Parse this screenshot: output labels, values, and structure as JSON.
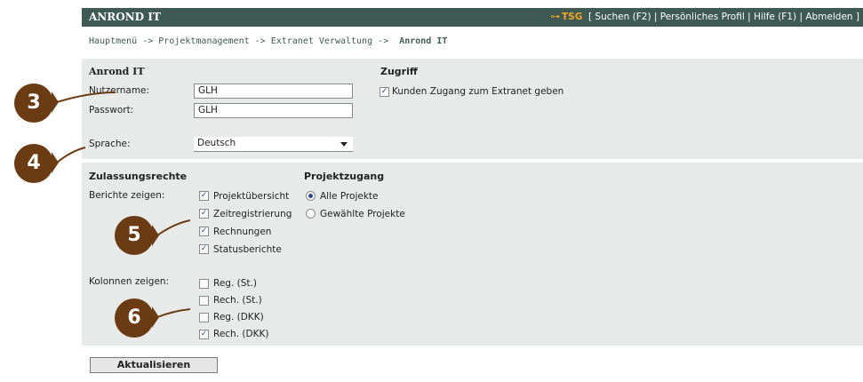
{
  "topbar": {
    "title": "ANROND IT",
    "user": "TSG",
    "links": "[ Suchen (F2) | Persönliches Profil | Hilfe (F1) | Abmelden ]"
  },
  "breadcrumb": {
    "path": "Hauptmenü -> Projektmanagement -> Extranet Verwaltung ->",
    "current": "Anrond IT"
  },
  "account": {
    "heading": "Anrond IT",
    "username_label": "Nutzername:",
    "username_value": "GLH",
    "password_label": "Passwort:",
    "password_value": "GLH",
    "language_label": "Sprache:",
    "language_value": "Deutsch"
  },
  "access": {
    "heading": "Zugriff",
    "extranet_label": "Kunden Zugang zum Extranet geben",
    "extranet_checked": true
  },
  "permissions": {
    "heading": "Zulassungsrechte",
    "reports_label": "Berichte zeigen:",
    "reports": [
      {
        "label": "Projektübersicht",
        "checked": true
      },
      {
        "label": "Zeitregistrierung",
        "checked": true
      },
      {
        "label": "Rechnungen",
        "checked": true
      },
      {
        "label": "Statusberichte",
        "checked": true
      }
    ],
    "columns_label": "Kolonnen zeigen:",
    "columns": [
      {
        "label": "Reg. (St.)",
        "checked": false
      },
      {
        "label": "Rech. (St.)",
        "checked": false
      },
      {
        "label": "Reg. (DKK)",
        "checked": false
      },
      {
        "label": "Rech. (DKK)",
        "checked": true
      }
    ]
  },
  "project_access": {
    "heading": "Projektzugang",
    "options": [
      {
        "label": "Alle Projekte",
        "selected": true
      },
      {
        "label": "Gewählte Projekte",
        "selected": false
      }
    ]
  },
  "update_button": "Aktualisieren",
  "callouts": [
    "3",
    "4",
    "5",
    "6"
  ],
  "colors": {
    "header_bg": "#3f5a53",
    "panel_bg": "#e8eaea",
    "badge": "#6b3c14",
    "accent": "#f5a623"
  }
}
